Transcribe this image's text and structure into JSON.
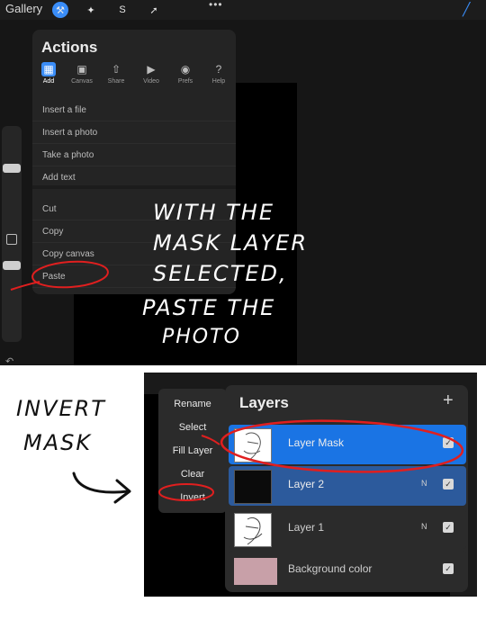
{
  "toolbar": {
    "gallery": "Gallery",
    "icons": [
      "wrench-icon",
      "magic-wand-icon",
      "selection-icon",
      "move-arrow-icon",
      "more-icon",
      "brush-icon"
    ]
  },
  "actions": {
    "title": "Actions",
    "tabs": [
      {
        "label": "Add",
        "icon": "add-file-icon",
        "active": true
      },
      {
        "label": "Canvas",
        "icon": "canvas-icon",
        "active": false
      },
      {
        "label": "Share",
        "icon": "share-icon",
        "active": false
      },
      {
        "label": "Video",
        "icon": "play-icon",
        "active": false
      },
      {
        "label": "Prefs",
        "icon": "toggle-icon",
        "active": false
      },
      {
        "label": "Help",
        "icon": "help-icon",
        "active": false
      }
    ],
    "items": [
      "Insert a file",
      "Insert a photo",
      "Take a photo",
      "Add text",
      "Cut",
      "Copy",
      "Copy canvas",
      "Paste"
    ]
  },
  "annotation_top": [
    "WITH THE",
    "MASK LAYER",
    "SELECTED,",
    "PASTE THE",
    "PHOTO"
  ],
  "annotation_bottom": [
    "INVERT",
    "MASK"
  ],
  "layer_menu": [
    "Rename",
    "Select",
    "Fill Layer",
    "Clear",
    "Invert"
  ],
  "layers": {
    "title": "Layers",
    "rows": [
      {
        "name": "Layer Mask",
        "mode": "",
        "checked": true
      },
      {
        "name": "Layer 2",
        "mode": "N",
        "checked": true
      },
      {
        "name": "Layer 1",
        "mode": "N",
        "checked": true
      },
      {
        "name": "Background color",
        "mode": "",
        "checked": true
      }
    ]
  },
  "colors": {
    "accent_blue": "#3a8df8",
    "selected_row": "#1a74e4",
    "secondary_row": "#2c5a9c",
    "annotation_red": "#e01f1f",
    "background_swatch": "#c8a0a8"
  }
}
